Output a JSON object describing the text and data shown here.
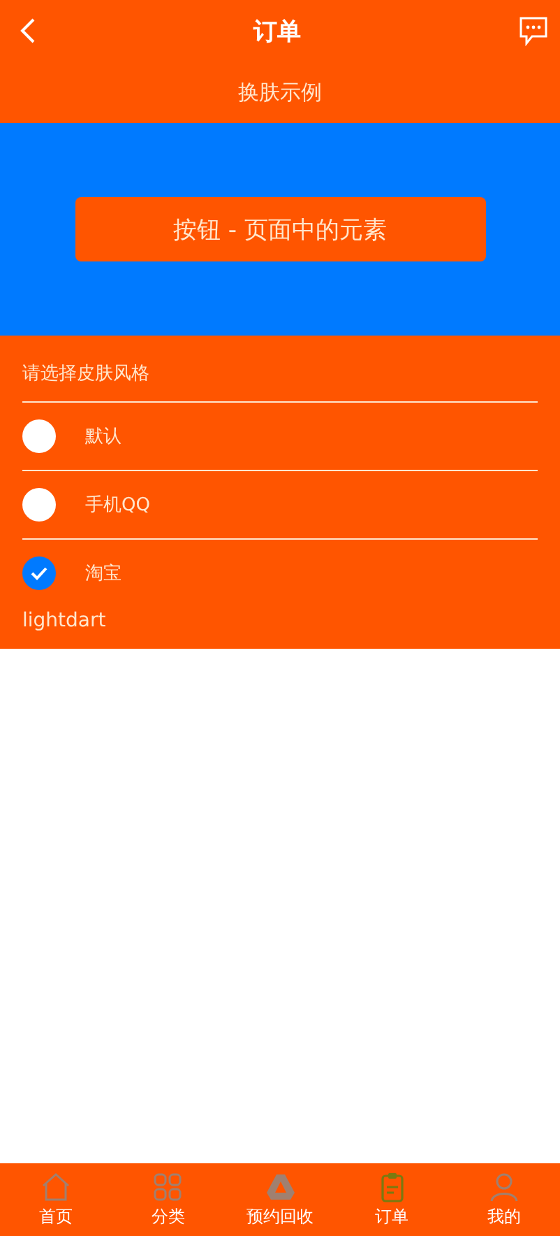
{
  "header": {
    "title": "订单"
  },
  "subtitle": "换肤示例",
  "banner": {
    "button": "按钮 - 页面中的元素"
  },
  "skin_picker": {
    "prompt": "请选择皮肤风格",
    "options": [
      {
        "label": "默认",
        "selected": false
      },
      {
        "label": "手机QQ",
        "selected": false
      },
      {
        "label": "淘宝",
        "selected": true
      }
    ],
    "current": "lightdart"
  },
  "tab_bar": [
    {
      "label": "首页",
      "kind": "home",
      "selected": false
    },
    {
      "label": "分类",
      "kind": "grid",
      "selected": false
    },
    {
      "label": "预约回收",
      "kind": "triangle",
      "selected": false
    },
    {
      "label": "订单",
      "kind": "clipboard",
      "selected": true
    },
    {
      "label": "我的",
      "kind": "person",
      "selected": false
    }
  ]
}
